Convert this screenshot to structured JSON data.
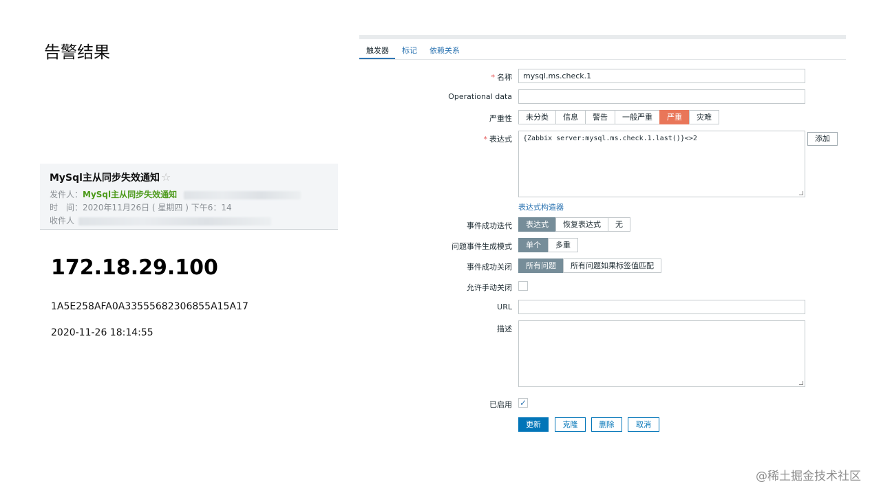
{
  "slide_title": "告警结果",
  "email": {
    "subject": "MySql主从同步失效通知",
    "star_icon": "☆",
    "sender_label": "发件人：",
    "sender_name": "MySql主从同步失效通知",
    "time_label": "时　间：",
    "time_value": "2020年11月26日 ( 星期四 ) 下午6：14",
    "recipient_label": "收件人"
  },
  "alert": {
    "ip": "172.18.29.100",
    "hash": "1A5E258AFA0A33555682306855A15A17",
    "time": "2020-11-26 18:14:55"
  },
  "trigger_form": {
    "tabs": [
      "触发器",
      "标记",
      "依赖关系"
    ],
    "active_tab": "触发器",
    "required_mark": "*",
    "name_label": "名称",
    "name_value": "mysql.ms.check.1",
    "opdata_label": "Operational data",
    "opdata_value": "",
    "severity_label": "严重性",
    "severity_options": [
      "未分类",
      "信息",
      "警告",
      "一般严重",
      "严重",
      "灾难"
    ],
    "severity_selected": "严重",
    "expression_label": "表达式",
    "expression_value": "{Zabbix server:mysql.ms.check.1.last()}<>2",
    "add_button": "添加",
    "expression_builder_link": "表达式构造器",
    "ok_event_generation_label": "事件成功迭代",
    "ok_event_generation_options": [
      "表达式",
      "恢复表达式",
      "无"
    ],
    "ok_event_generation_selected": "表达式",
    "problem_mode_label": "问题事件生成模式",
    "problem_mode_options": [
      "单个",
      "多重"
    ],
    "problem_mode_selected": "单个",
    "ok_event_closes_label": "事件成功关闭",
    "ok_event_closes_options": [
      "所有问题",
      "所有问题如果标签值匹配"
    ],
    "ok_event_closes_selected": "所有问题",
    "manual_close_label": "允许手动关闭",
    "manual_close_checked": false,
    "url_label": "URL",
    "url_value": "",
    "description_label": "描述",
    "description_value": "",
    "enabled_label": "已启用",
    "enabled_checked": true,
    "checkmark_icon": "✓",
    "buttons": {
      "update": "更新",
      "clone": "克隆",
      "delete": "删除",
      "cancel": "取消"
    },
    "colors": {
      "primary": "#0275b8",
      "selected_gray": "#768d99",
      "severity_high": "#e97659",
      "required": "#e45959"
    }
  },
  "watermark": "@稀土掘金技术社区"
}
